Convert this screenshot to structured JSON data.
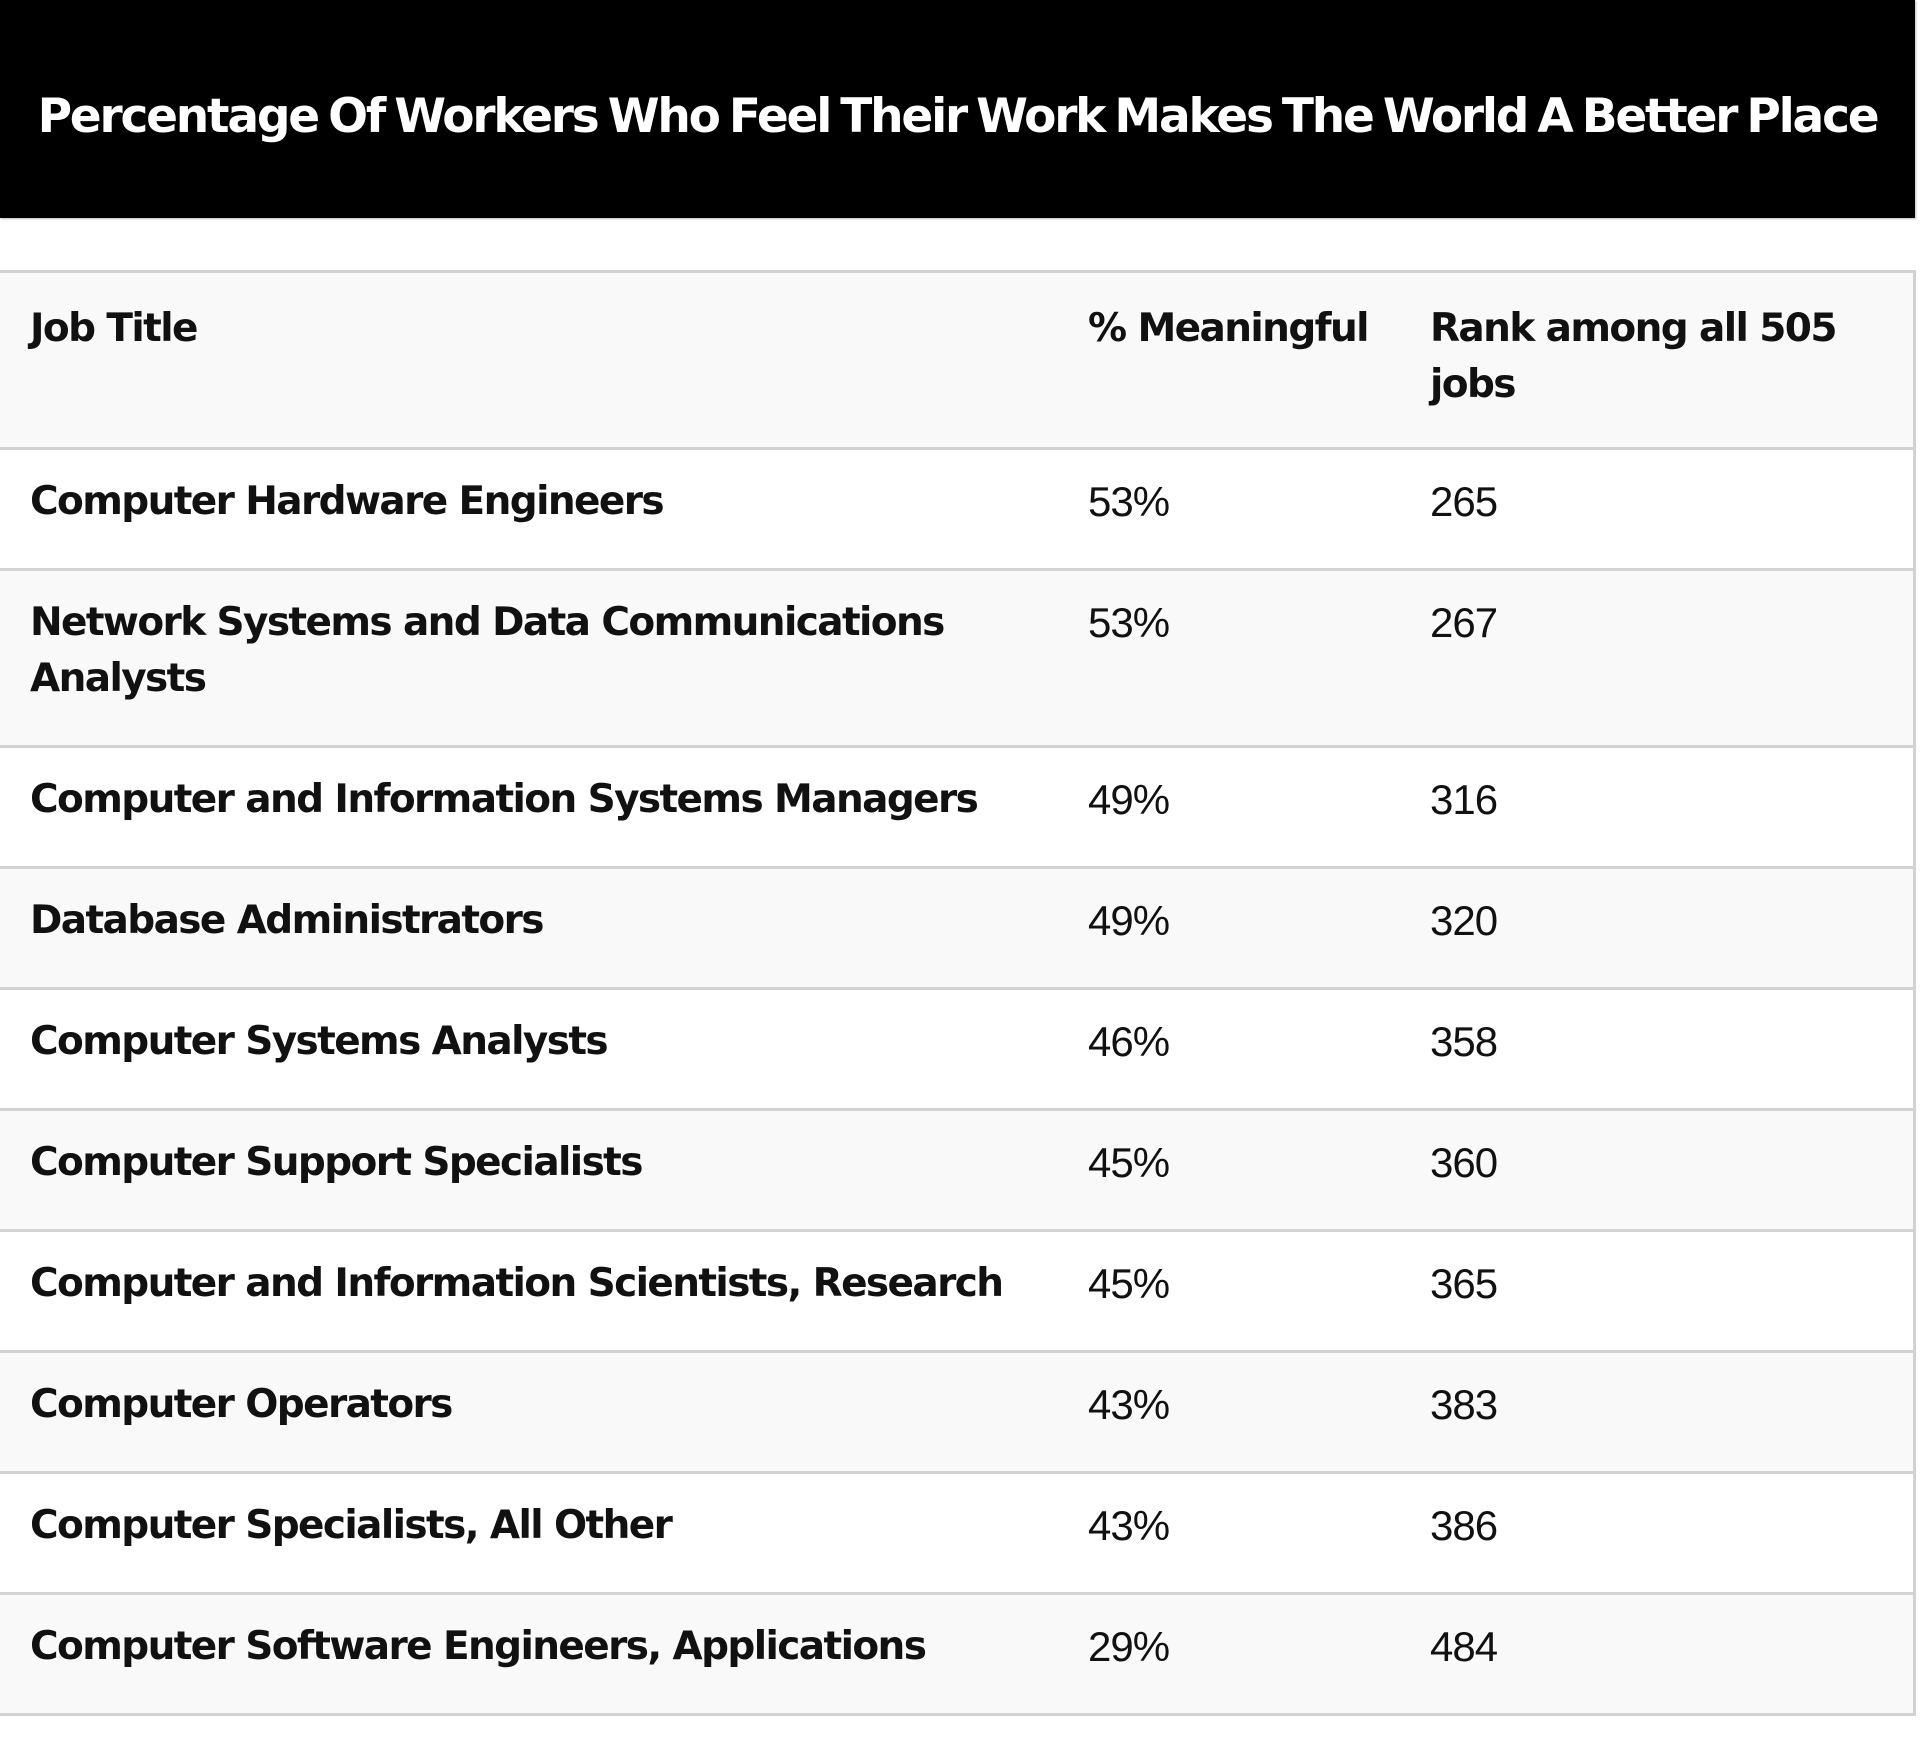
{
  "title": "Percentage Of Workers Who Feel Their Work Makes The World A Better Place",
  "table": {
    "headers": [
      "Job Title",
      "% Meaningful",
      "Rank among all 505 jobs"
    ],
    "rows": [
      {
        "job_title": "Computer Hardware Engineers",
        "pct_meaningful": "53%",
        "rank": "265"
      },
      {
        "job_title": "Network Systems and Data Communications Analysts",
        "pct_meaningful": "53%",
        "rank": "267"
      },
      {
        "job_title": "Computer and Information Systems Managers",
        "pct_meaningful": "49%",
        "rank": "316"
      },
      {
        "job_title": "Database Administrators",
        "pct_meaningful": "49%",
        "rank": "320"
      },
      {
        "job_title": "Computer Systems Analysts",
        "pct_meaningful": "46%",
        "rank": "358"
      },
      {
        "job_title": "Computer Support Specialists",
        "pct_meaningful": "45%",
        "rank": "360"
      },
      {
        "job_title": "Computer and Information Scientists, Research",
        "pct_meaningful": "45%",
        "rank": "365"
      },
      {
        "job_title": "Computer Operators",
        "pct_meaningful": "43%",
        "rank": "383"
      },
      {
        "job_title": "Computer Specialists, All Other",
        "pct_meaningful": "43%",
        "rank": "386"
      },
      {
        "job_title": "Computer Software Engineers, Applications",
        "pct_meaningful": "29%",
        "rank": "484"
      }
    ]
  },
  "colors": {
    "title_background": "#000000",
    "title_text": "#ffffff",
    "row_alt_background": "#f9f9f9",
    "border": "#d2d2d2"
  }
}
